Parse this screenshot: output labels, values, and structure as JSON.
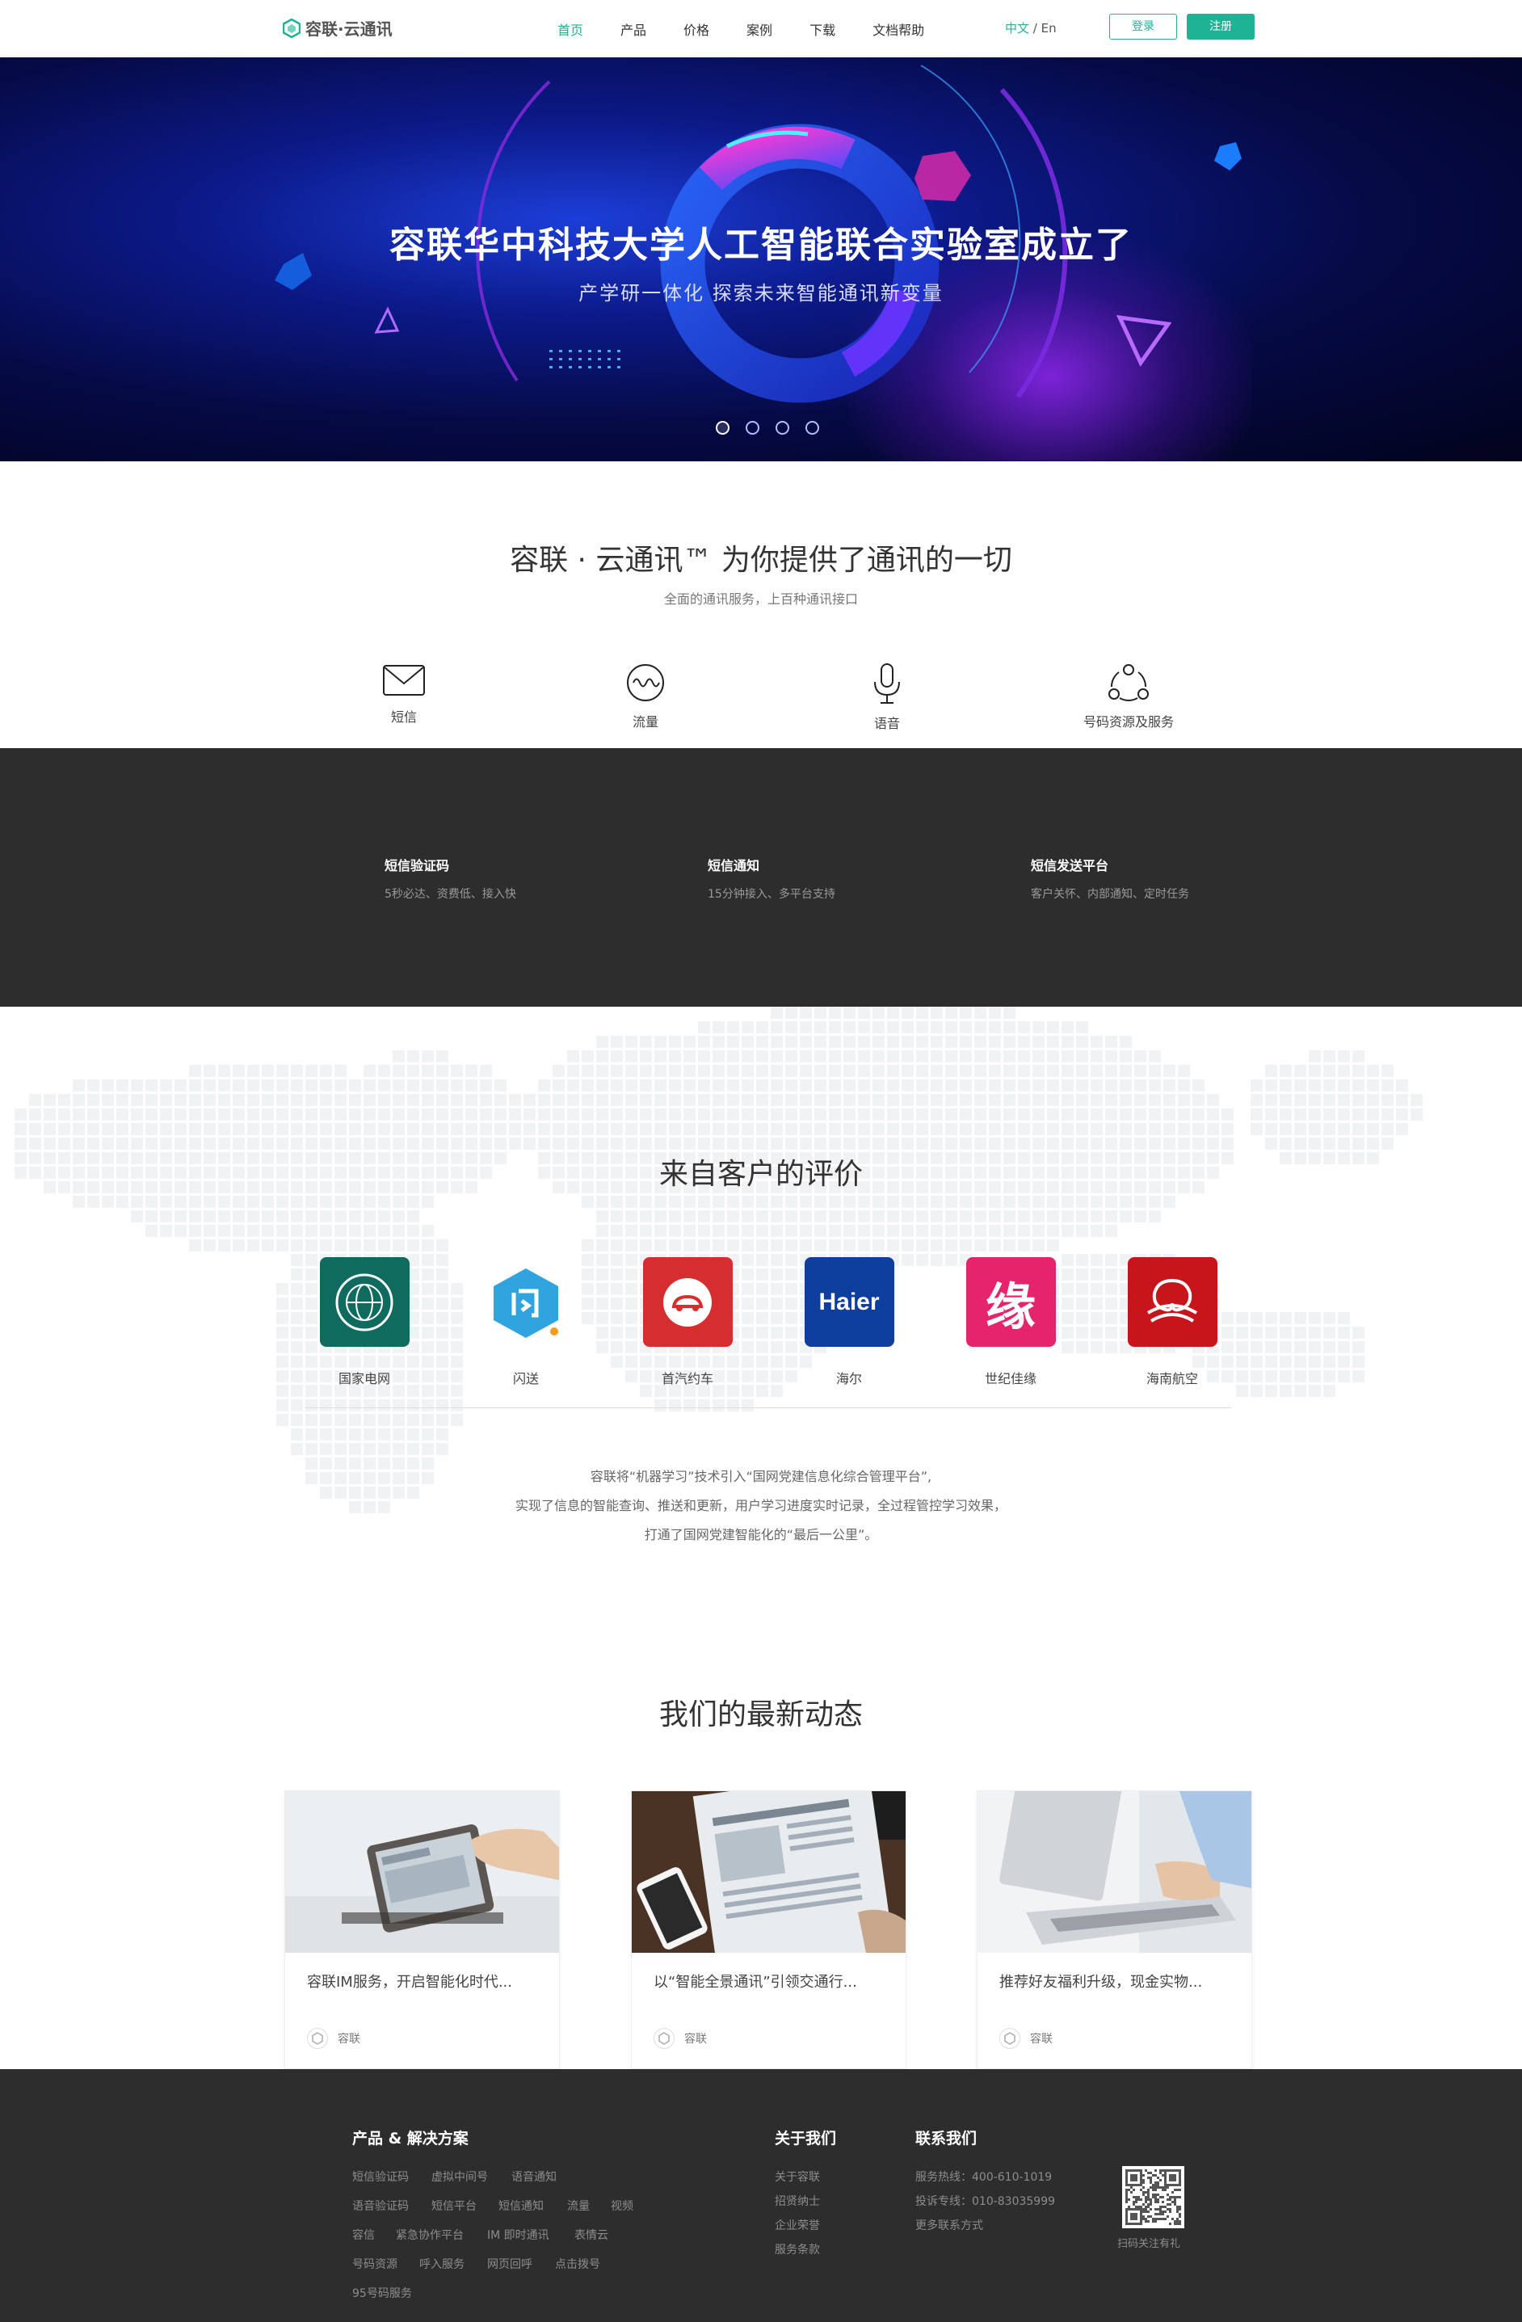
{
  "brand": {
    "name": "容联·云通讯",
    "accent": "#1fb396"
  },
  "nav": {
    "items": [
      "首页",
      "产品",
      "价格",
      "案例",
      "下载",
      "文档帮助"
    ],
    "active": "首页"
  },
  "lang": {
    "current": "中文",
    "sep": " / ",
    "other": "En"
  },
  "auth": {
    "login": "登录",
    "register": "注册"
  },
  "hero": {
    "title": "容联华中科技大学人工智能联合实验室成立了",
    "subtitle": "产学研一体化 探索未来智能通讯新变量",
    "slides_total": 4,
    "slide_active": 1
  },
  "intro": {
    "title": "容联 · 云通讯™ 为你提供了通讯的一切",
    "subtitle": "全面的通讯服务，上百种通讯接口",
    "services": [
      {
        "icon": "mail-icon",
        "label": "短信"
      },
      {
        "icon": "wave-icon",
        "label": "流量"
      },
      {
        "icon": "microphone-icon",
        "label": "语音"
      },
      {
        "icon": "network-icon",
        "label": "号码资源及服务"
      }
    ]
  },
  "features": [
    {
      "title": "短信验证码",
      "desc": "5秒必达、资费低、接入快"
    },
    {
      "title": "短信通知",
      "desc": "15分钟接入、多平台支持"
    },
    {
      "title": "短信发送平台",
      "desc": "客户关怀、内部通知、定时任务"
    }
  ],
  "testimonials": {
    "title": "来自客户的评价",
    "clients": [
      {
        "name": "国家电网",
        "color": "#0f6b5e",
        "icon": "state-grid-logo"
      },
      {
        "name": "闪送",
        "color": "#2fa4df",
        "icon": "shansong-logo"
      },
      {
        "name": "首汽约车",
        "color": "#d62e2e",
        "icon": "shouqi-logo"
      },
      {
        "name": "海尔",
        "color": "#0f3f9e",
        "icon": "haier-logo",
        "logo_text": "Haier"
      },
      {
        "name": "世纪佳缘",
        "color": "#e6236d",
        "icon": "jiayuan-logo",
        "logo_text": "缘"
      },
      {
        "name": "海南航空",
        "color": "#c8141b",
        "icon": "hainan-airlines-logo"
      }
    ],
    "quote": [
      "容联将“机器学习”技术引入“国网党建信息化综合管理平台”,",
      "实现了信息的智能查询、推送和更新，用户学习进度实时记录，全过程管控学习效果，",
      "打通了国网党建智能化的“最后一公里”。"
    ]
  },
  "news": {
    "title": "我们的最新动态",
    "cards": [
      {
        "title": "容联IM服务，开启智能化时代...",
        "source": "容联"
      },
      {
        "title": "以“智能全景通讯”引领交通行...",
        "source": "容联"
      },
      {
        "title": "推荐好友福利升级，现金实物...",
        "source": "容联"
      }
    ]
  },
  "footer": {
    "products": {
      "heading": "产品 & 解决方案",
      "rows": [
        [
          "短信验证码",
          "虚拟中间号",
          "语音通知"
        ],
        [
          "语音验证码",
          "短信平台",
          "短信通知",
          "流量",
          "视频"
        ],
        [
          "容信",
          "紧急协作平台",
          "IM 即时通讯",
          "表情云"
        ],
        [
          "号码资源",
          "呼入服务",
          "网页回呼",
          "点击拨号"
        ],
        [
          "95号码服务"
        ]
      ]
    },
    "about": {
      "heading": "关于我们",
      "links": [
        "关于容联",
        "招贤纳士",
        "企业荣誉",
        "服务条款"
      ]
    },
    "contact": {
      "heading": "联系我们",
      "lines": [
        "服务热线：400-610-1019",
        "投诉专线：010-83035999",
        "更多联系方式"
      ]
    },
    "qr_caption": "扫码关注有礼"
  }
}
